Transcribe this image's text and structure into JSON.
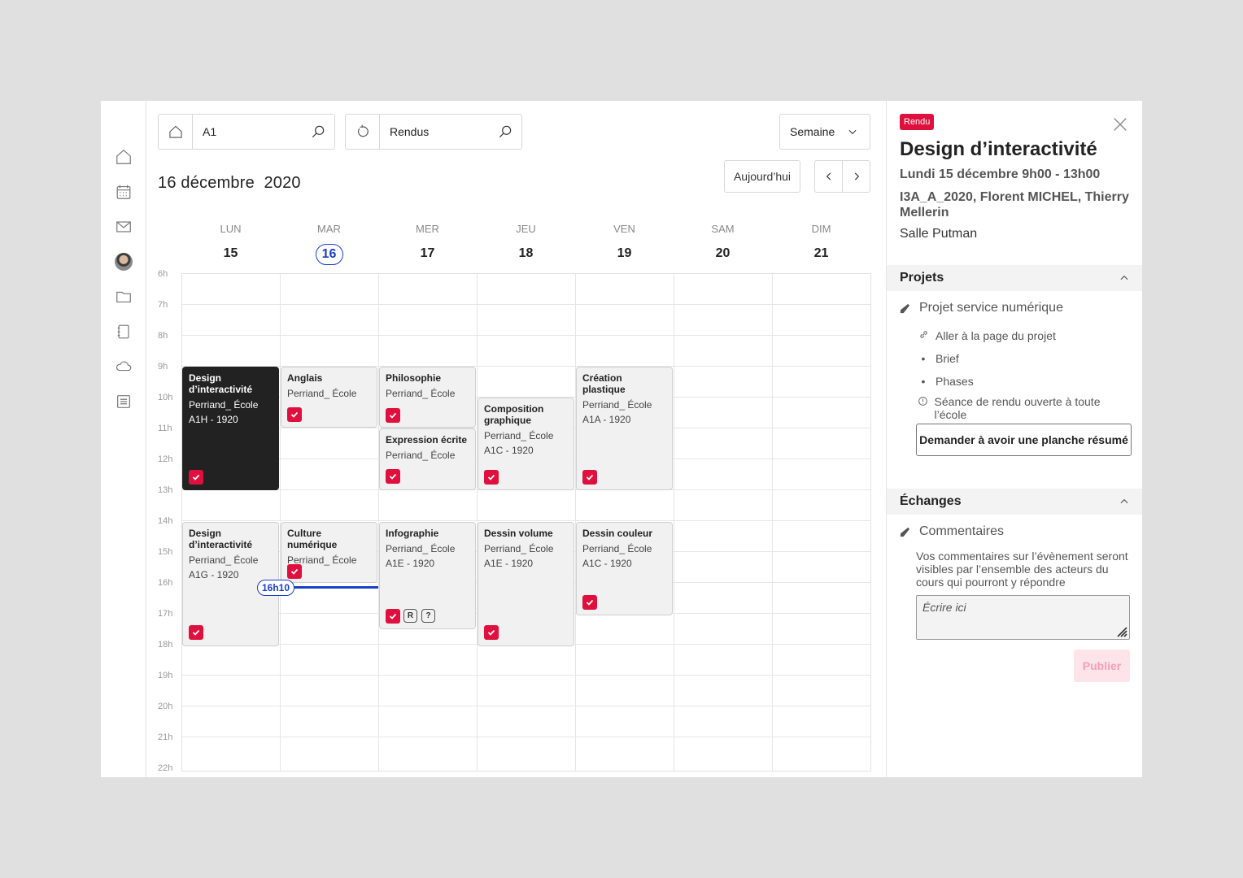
{
  "sidebar": {
    "items": [
      {
        "icon": "home-icon"
      },
      {
        "icon": "calendar-icon"
      },
      {
        "icon": "mail-icon"
      },
      {
        "icon": "avatar"
      },
      {
        "icon": "folder-icon"
      },
      {
        "icon": "notebook-icon"
      },
      {
        "icon": "cloud-icon"
      },
      {
        "icon": "list-icon"
      }
    ]
  },
  "toolbar": {
    "group_search": {
      "value": "A1"
    },
    "type_search": {
      "value": "Rendus"
    },
    "view_select": "Semaine",
    "today_label": "Aujourd’hui"
  },
  "calendar": {
    "title": "16 décembre  2020",
    "days": [
      {
        "name": "LUN",
        "num": "15"
      },
      {
        "name": "MAR",
        "num": "16"
      },
      {
        "name": "MER",
        "num": "17"
      },
      {
        "name": "JEU",
        "num": "18"
      },
      {
        "name": "VEN",
        "num": "19"
      },
      {
        "name": "SAM",
        "num": "20"
      },
      {
        "name": "DIM",
        "num": "21"
      }
    ],
    "hours": [
      "6h",
      "7h",
      "8h",
      "9h",
      "10h",
      "11h",
      "12h",
      "13h",
      "14h",
      "15h",
      "16h",
      "17h",
      "18h",
      "19h",
      "20h",
      "21h",
      "22h"
    ],
    "now_label": "16h10",
    "events": [
      {
        "title": "Design d’interactivité",
        "school": "Perriand_ École",
        "group": "A1H - 1920",
        "dark": true
      },
      {
        "title": "Anglais",
        "school": "Perriand_ École"
      },
      {
        "title": "Philosophie",
        "school": "Perriand_ École"
      },
      {
        "title": "Expression écrite",
        "school": "Perriand_ École"
      },
      {
        "title": "Composition graphique",
        "school": "Perriand_ École",
        "group": "A1C - 1920"
      },
      {
        "title": "Création plastique",
        "school": "Perriand_ École",
        "group": "A1A - 1920"
      },
      {
        "title": "Design d’interactivité",
        "school": "Perriand_ École",
        "group": "A1G - 1920"
      },
      {
        "title": "Culture numérique",
        "school": "Perriand_ École"
      },
      {
        "title": "Infographie",
        "school": "Perriand_ École",
        "group": "A1E - 1920",
        "tags": [
          "R",
          "?"
        ]
      },
      {
        "title": "Dessin volume",
        "school": "Perriand_ École",
        "group": "A1E - 1920"
      },
      {
        "title": "Dessin couleur",
        "school": "Perriand_ École",
        "group": "A1C - 1920"
      }
    ]
  },
  "panel": {
    "badge": "Rendu",
    "title": "Design d’interactivité",
    "date": "Lundi 15 décembre 9h00 - 13h00",
    "people": "I3A_A_2020, Florent MICHEL, Thierry Mellerin",
    "room": "Salle Putman",
    "projects_section": "Projets",
    "project_name": "Projet service numérique",
    "project_links": {
      "page": "Aller à la page du projet",
      "brief": "Brief",
      "phases": "Phases",
      "open_session": "Séance de rendu ouverte à toute l’école"
    },
    "ask_button": "Demander à avoir une planche résumé",
    "exchanges_section": "Échanges",
    "comments_title": "Commentaires",
    "comments_help": "Vos commentaires sur l’évènement seront visibles par l’ensemble des acteurs du cours qui pourront y répondre",
    "comment_placeholder": "Écrire ici",
    "publish_button": "Publier"
  },
  "colors": {
    "accent_red": "#e0103e",
    "current_blue": "#1a3fc8",
    "event_bg": "#f1f1f1",
    "dark_event_bg": "#222222"
  }
}
